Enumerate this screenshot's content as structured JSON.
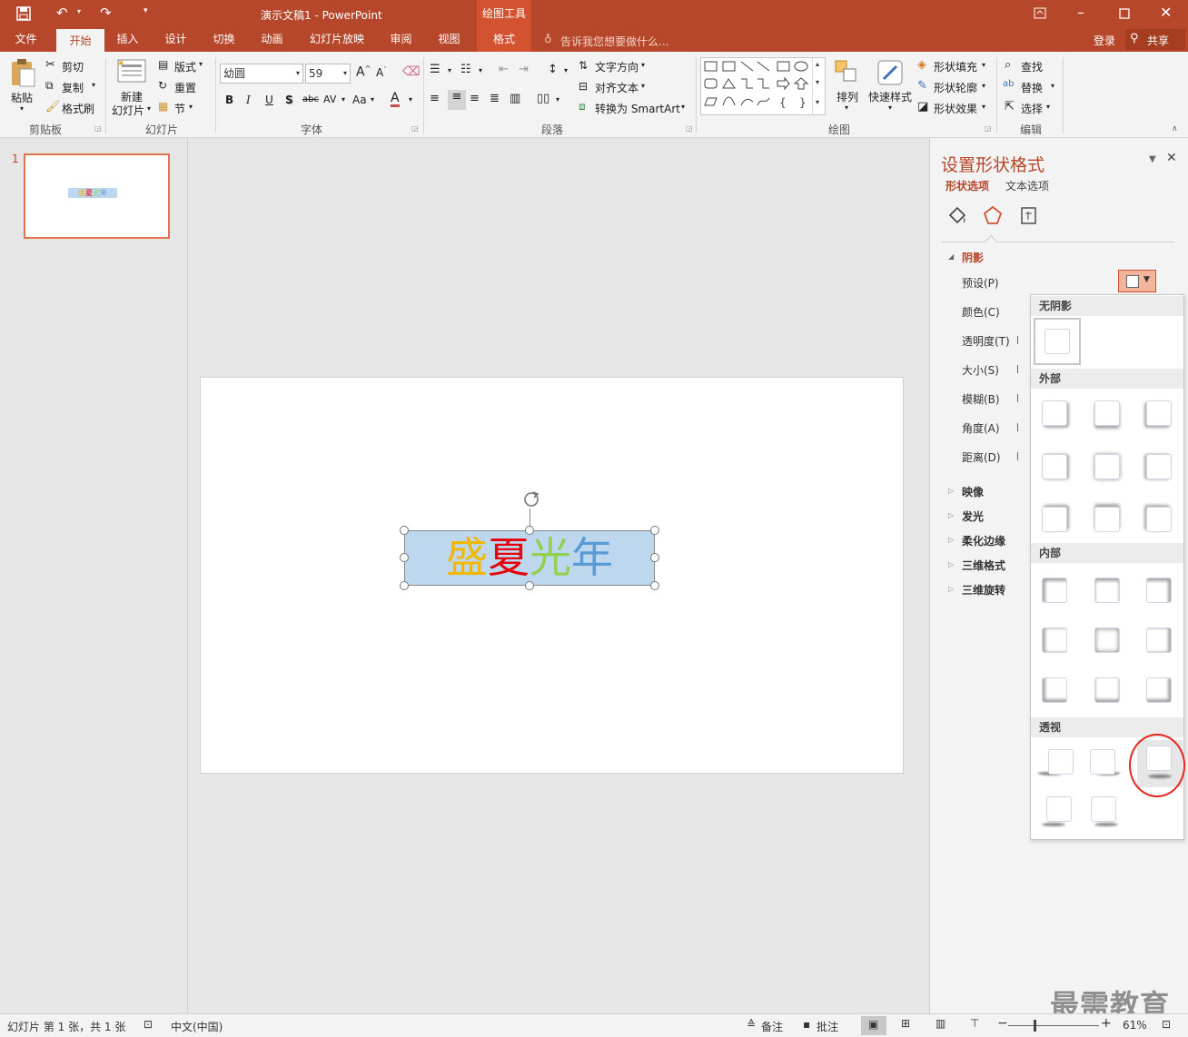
{
  "titlebar": {
    "doc_title": "演示文稿1 - PowerPoint",
    "context_tab_title": "绘图工具"
  },
  "tabs": [
    "文件",
    "开始",
    "插入",
    "设计",
    "切换",
    "动画",
    "幻灯片放映",
    "审阅",
    "视图",
    "格式"
  ],
  "active_tab": "开始",
  "tell_me": "告诉我您想要做什么...",
  "account": {
    "login": "登录",
    "share": "共享"
  },
  "ribbon": {
    "clipboard": {
      "paste": "粘贴",
      "cut": "剪切",
      "copy": "复制",
      "format_painter": "格式刷",
      "label": "剪贴板"
    },
    "slides": {
      "new_slide_1": "新建",
      "new_slide_2": "幻灯片",
      "layout": "版式",
      "reset": "重置",
      "section": "节",
      "label": "幻灯片"
    },
    "font": {
      "name": "幼圆",
      "size": "59",
      "label": "字体",
      "bold": "B",
      "italic": "I",
      "underline": "U",
      "shadow": "S",
      "strike": "abc",
      "spacing": "AV",
      "case": "Aa",
      "color_a": "A"
    },
    "paragraph": {
      "text_direction": "文字方向",
      "align_text": "对齐文本",
      "smartart": "转换为 SmartArt",
      "label": "段落"
    },
    "drawing": {
      "arrange": "排列",
      "quick_styles": "快速样式",
      "fill": "形状填充",
      "outline": "形状轮廓",
      "effects": "形状效果",
      "label": "绘图"
    },
    "editing": {
      "find": "查找",
      "replace": "替换",
      "select": "选择",
      "label": "编辑"
    }
  },
  "thumbnail": {
    "number": "1",
    "text": "盛夏光年"
  },
  "slide": {
    "chars": [
      {
        "ch": "盛",
        "color": "#f2b800"
      },
      {
        "ch": "夏",
        "color": "#e8000b"
      },
      {
        "ch": "光",
        "color": "#92d050"
      },
      {
        "ch": "年",
        "color": "#5b9bd5"
      }
    ],
    "box_fill": "#bdd7ee"
  },
  "format_pane": {
    "title": "设置形状格式",
    "tab_shape": "形状选项",
    "tab_text": "文本选项",
    "shadow_section": "阴影",
    "props": [
      "预设(P)",
      "颜色(C)",
      "透明度(T)",
      "大小(S)",
      "模糊(B)",
      "角度(A)",
      "距离(D)"
    ],
    "sections": [
      "映像",
      "发光",
      "柔化边缘",
      "三维格式",
      "三维旋转"
    ]
  },
  "gallery": {
    "no_shadow": "无阴影",
    "outer": "外部",
    "inner": "内部",
    "perspective": "透视"
  },
  "status": {
    "slide_info": "幻灯片 第 1 张，共 1 张",
    "language": "中文(中国)",
    "notes": "备注",
    "comments": "批注",
    "zoom": "61%"
  },
  "watermark": "最需教育",
  "colors": {
    "accent": "#b7472a",
    "highlight_circle": "#e8251f"
  }
}
